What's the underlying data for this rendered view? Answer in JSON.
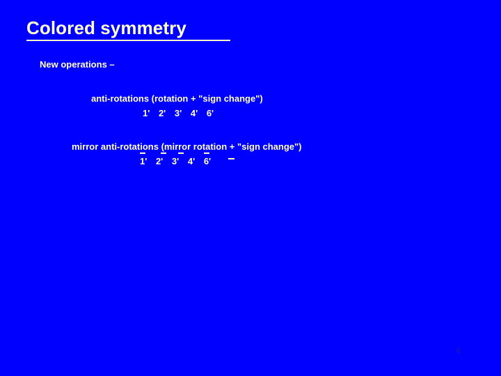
{
  "slide": {
    "background_color": "#0000FF",
    "text_color": "#FFFFCC",
    "title": "Colored symmetry",
    "lead_text": "New operations –",
    "groups": [
      {
        "heading": "anti-rotations (rotation + \"sign change\")",
        "symbols": [
          "1'",
          "2'",
          "3'",
          "4'",
          "6'"
        ],
        "has_overbars": false
      },
      {
        "heading": "mirror anti-rotations (mirror rotation + \"sign change\")",
        "symbols": [
          "1'",
          "2'",
          "3'",
          "4'",
          "6'"
        ],
        "has_overbars": true
      }
    ],
    "page_number": "6"
  }
}
